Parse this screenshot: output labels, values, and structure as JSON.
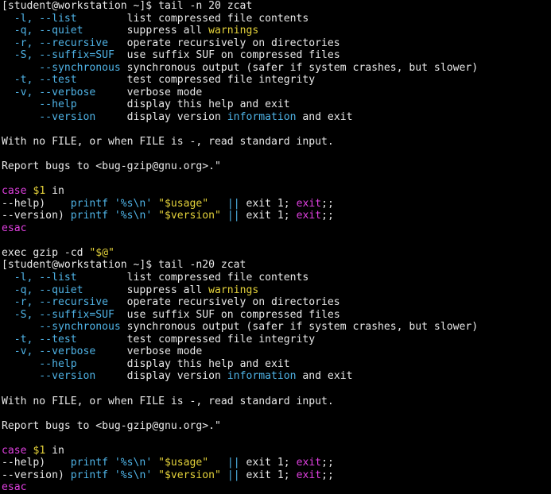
{
  "terminal": {
    "colors": {
      "background": "#000000",
      "text": "#e8e8e8",
      "option_cyan": "#4fb3e6",
      "keyword_yellow": "#e3d13a",
      "keyword_magenta": "#e040e0"
    },
    "lines": [
      [
        {
          "t": "[student@workstation ~]$ tail -n 20 zcat",
          "c": "default"
        }
      ],
      [
        {
          "t": "  -l, --list",
          "c": "cyan"
        },
        {
          "t": "        list compressed file contents",
          "c": "default"
        }
      ],
      [
        {
          "t": "  -q, --quiet",
          "c": "cyan"
        },
        {
          "t": "       suppress all ",
          "c": "default"
        },
        {
          "t": "warnings",
          "c": "yellow"
        }
      ],
      [
        {
          "t": "  -r, --recursive",
          "c": "cyan"
        },
        {
          "t": "   operate recursively on directories",
          "c": "default"
        }
      ],
      [
        {
          "t": "  -S, --suffix=SUF",
          "c": "cyan"
        },
        {
          "t": "  use suffix SUF on compressed files",
          "c": "default"
        }
      ],
      [
        {
          "t": "      --synchronous",
          "c": "cyan"
        },
        {
          "t": " synchronous output (safer if system crashes, but slower)",
          "c": "default"
        }
      ],
      [
        {
          "t": "  -t, --test",
          "c": "cyan"
        },
        {
          "t": "        test compressed file integrity",
          "c": "default"
        }
      ],
      [
        {
          "t": "  -v, --verbose",
          "c": "cyan"
        },
        {
          "t": "     verbose mode",
          "c": "default"
        }
      ],
      [
        {
          "t": "      --help",
          "c": "cyan"
        },
        {
          "t": "        display this help and exit",
          "c": "default"
        }
      ],
      [
        {
          "t": "      --version",
          "c": "cyan"
        },
        {
          "t": "     display version ",
          "c": "default"
        },
        {
          "t": "information",
          "c": "cyan"
        },
        {
          "t": " and exit",
          "c": "default"
        }
      ],
      [
        {
          "t": "",
          "c": "default"
        }
      ],
      [
        {
          "t": "With no FILE, or when FILE is -, read standard input.",
          "c": "default"
        }
      ],
      [
        {
          "t": "",
          "c": "default"
        }
      ],
      [
        {
          "t": "Report bugs to <bug-gzip@gnu.org>.\"",
          "c": "default"
        }
      ],
      [
        {
          "t": "",
          "c": "default"
        }
      ],
      [
        {
          "t": "case",
          "c": "magenta"
        },
        {
          "t": " ",
          "c": "default"
        },
        {
          "t": "$1",
          "c": "yellow"
        },
        {
          "t": " in",
          "c": "default"
        }
      ],
      [
        {
          "t": "--help)",
          "c": "default"
        },
        {
          "t": "    printf '%s\\n' ",
          "c": "cyan"
        },
        {
          "t": "\"$usage\"",
          "c": "yellow"
        },
        {
          "t": "   ",
          "c": "default"
        },
        {
          "t": "||",
          "c": "cyan"
        },
        {
          "t": " exit 1; ",
          "c": "default"
        },
        {
          "t": "exit",
          "c": "magenta"
        },
        {
          "t": ";;",
          "c": "default"
        }
      ],
      [
        {
          "t": "--version)",
          "c": "default"
        },
        {
          "t": " printf '%s\\n' ",
          "c": "cyan"
        },
        {
          "t": "\"$version\"",
          "c": "yellow"
        },
        {
          "t": " ",
          "c": "default"
        },
        {
          "t": "||",
          "c": "cyan"
        },
        {
          "t": " exit 1; ",
          "c": "default"
        },
        {
          "t": "exit",
          "c": "magenta"
        },
        {
          "t": ";;",
          "c": "default"
        }
      ],
      [
        {
          "t": "esac",
          "c": "magenta"
        }
      ],
      [
        {
          "t": "",
          "c": "default"
        }
      ],
      [
        {
          "t": "exec gzip -cd ",
          "c": "default"
        },
        {
          "t": "\"$@\"",
          "c": "yellow"
        }
      ],
      [
        {
          "t": "[student@workstation ~]$ tail -n20 zcat",
          "c": "default"
        }
      ],
      [
        {
          "t": "  -l, --list",
          "c": "cyan"
        },
        {
          "t": "        list compressed file contents",
          "c": "default"
        }
      ],
      [
        {
          "t": "  -q, --quiet",
          "c": "cyan"
        },
        {
          "t": "       suppress all ",
          "c": "default"
        },
        {
          "t": "warnings",
          "c": "yellow"
        }
      ],
      [
        {
          "t": "  -r, --recursive",
          "c": "cyan"
        },
        {
          "t": "   operate recursively on directories",
          "c": "default"
        }
      ],
      [
        {
          "t": "  -S, --suffix=SUF",
          "c": "cyan"
        },
        {
          "t": "  use suffix SUF on compressed files",
          "c": "default"
        }
      ],
      [
        {
          "t": "      --synchronous",
          "c": "cyan"
        },
        {
          "t": " synchronous output (safer if system crashes, but slower)",
          "c": "default"
        }
      ],
      [
        {
          "t": "  -t, --test",
          "c": "cyan"
        },
        {
          "t": "        test compressed file integrity",
          "c": "default"
        }
      ],
      [
        {
          "t": "  -v, --verbose",
          "c": "cyan"
        },
        {
          "t": "     verbose mode",
          "c": "default"
        }
      ],
      [
        {
          "t": "      --help",
          "c": "cyan"
        },
        {
          "t": "        display this help and exit",
          "c": "default"
        }
      ],
      [
        {
          "t": "      --version",
          "c": "cyan"
        },
        {
          "t": "     display version ",
          "c": "default"
        },
        {
          "t": "information",
          "c": "cyan"
        },
        {
          "t": " and exit",
          "c": "default"
        }
      ],
      [
        {
          "t": "",
          "c": "default"
        }
      ],
      [
        {
          "t": "With no FILE, or when FILE is -, read standard input.",
          "c": "default"
        }
      ],
      [
        {
          "t": "",
          "c": "default"
        }
      ],
      [
        {
          "t": "Report bugs to <bug-gzip@gnu.org>.\"",
          "c": "default"
        }
      ],
      [
        {
          "t": "",
          "c": "default"
        }
      ],
      [
        {
          "t": "case",
          "c": "magenta"
        },
        {
          "t": " ",
          "c": "default"
        },
        {
          "t": "$1",
          "c": "yellow"
        },
        {
          "t": " in",
          "c": "default"
        }
      ],
      [
        {
          "t": "--help)",
          "c": "default"
        },
        {
          "t": "    printf '%s\\n' ",
          "c": "cyan"
        },
        {
          "t": "\"$usage\"",
          "c": "yellow"
        },
        {
          "t": "   ",
          "c": "default"
        },
        {
          "t": "||",
          "c": "cyan"
        },
        {
          "t": " exit 1; ",
          "c": "default"
        },
        {
          "t": "exit",
          "c": "magenta"
        },
        {
          "t": ";;",
          "c": "default"
        }
      ],
      [
        {
          "t": "--version)",
          "c": "default"
        },
        {
          "t": " printf '%s\\n' ",
          "c": "cyan"
        },
        {
          "t": "\"$version\"",
          "c": "yellow"
        },
        {
          "t": " ",
          "c": "default"
        },
        {
          "t": "||",
          "c": "cyan"
        },
        {
          "t": " exit 1; ",
          "c": "default"
        },
        {
          "t": "exit",
          "c": "magenta"
        },
        {
          "t": ";;",
          "c": "default"
        }
      ],
      [
        {
          "t": "esac",
          "c": "magenta"
        }
      ]
    ]
  }
}
